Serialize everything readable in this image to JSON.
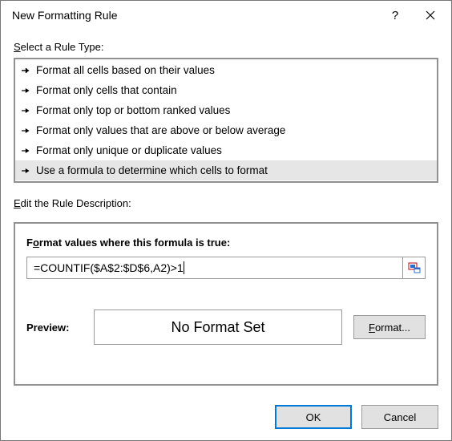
{
  "title": "New Formatting Rule",
  "sections": {
    "select_label_ul": "S",
    "select_label_rest": "elect a Rule Type:",
    "edit_label_ul": "E",
    "edit_label_rest": "dit the Rule Description:"
  },
  "rule_types": [
    "Format all cells based on their values",
    "Format only cells that contain",
    "Format only top or bottom ranked values",
    "Format only values that are above or below average",
    "Format only unique or duplicate values",
    "Use a formula to determine which cells to format"
  ],
  "description_panel": {
    "heading_prefix": "F",
    "heading_ul": "o",
    "heading_rest": "rmat values where this formula is true:",
    "formula": "=COUNTIF($A$2:$D$6,A2)>1",
    "preview_label": "Preview:",
    "preview_text": "No Format Set",
    "format_btn_ul": "F",
    "format_btn_rest": "ormat..."
  },
  "buttons": {
    "ok": "OK",
    "cancel": "Cancel"
  }
}
